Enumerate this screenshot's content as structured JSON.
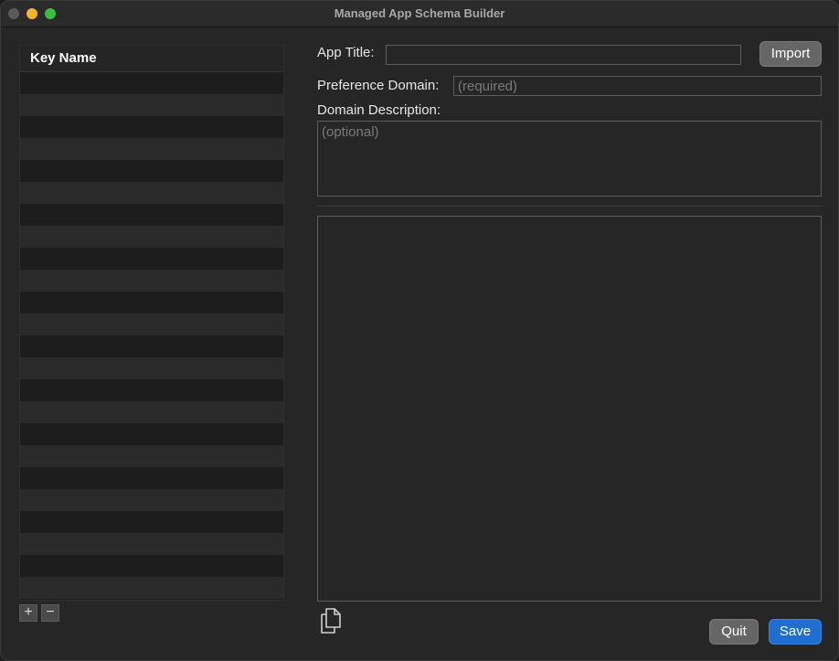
{
  "window": {
    "title": "Managed App Schema Builder"
  },
  "key_table": {
    "header": "Key Name",
    "rows": [
      "",
      "",
      "",
      "",
      "",
      "",
      "",
      "",
      "",
      "",
      "",
      "",
      "",
      "",
      "",
      "",
      "",
      "",
      "",
      "",
      "",
      "",
      "",
      "",
      ""
    ]
  },
  "key_buttons": {
    "add_label": "+",
    "remove_label": "−"
  },
  "form": {
    "app_title_label": "App Title:",
    "app_title_value": "",
    "import_label": "Import",
    "pref_domain_label": "Preference Domain:",
    "pref_domain_placeholder": "(required)",
    "domain_desc_label": "Domain Description:",
    "domain_desc_placeholder": "(optional)",
    "output_value": ""
  },
  "actions": {
    "copy_icon": "copy-documents-icon",
    "quit_label": "Quit",
    "save_label": "Save"
  },
  "colors": {
    "accent": "#1f6fd1",
    "close": "#5b5b5b",
    "minimize": "#f5b331",
    "maximize": "#35c03f"
  }
}
